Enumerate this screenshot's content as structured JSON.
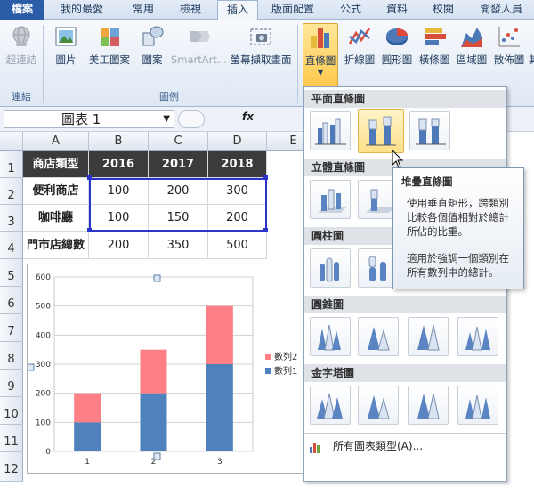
{
  "tabs": [
    "檔案",
    "我的最愛",
    "常用",
    "檢視",
    "插入",
    "版面配置",
    "公式",
    "資料",
    "校閱",
    "開發人員"
  ],
  "ribbon": {
    "buttons": [
      {
        "label": "超連結",
        "icon": "globe-link-icon"
      },
      {
        "label": "圖片",
        "icon": "picture-icon"
      },
      {
        "label": "美工圖案",
        "icon": "clipart-icon"
      },
      {
        "label": "圖案",
        "icon": "shapes-icon"
      },
      {
        "label": "SmartArt...",
        "icon": "smartart-icon"
      },
      {
        "label": "螢幕擷取畫面",
        "icon": "screenshot-icon"
      },
      {
        "label": "直條圖",
        "icon": "column-chart-icon"
      },
      {
        "label": "折線圖",
        "icon": "line-chart-icon"
      },
      {
        "label": "圓形圖",
        "icon": "pie-chart-icon"
      },
      {
        "label": "橫條圖",
        "icon": "bar-chart-icon"
      },
      {
        "label": "區域圖",
        "icon": "area-chart-icon"
      },
      {
        "label": "散佈圖",
        "icon": "scatter-chart-icon"
      },
      {
        "label": "其"
      }
    ],
    "groups": [
      "連結",
      "圖例"
    ]
  },
  "namebox": "圖表 1",
  "fx": "fx",
  "columns": [
    "A",
    "B",
    "C",
    "D",
    "E"
  ],
  "rows": [
    "1",
    "2",
    "3",
    "4",
    "5",
    "6",
    "7",
    "8",
    "9",
    "10",
    "11",
    "12"
  ],
  "table": {
    "header": [
      "商店類型",
      "2016",
      "2017",
      "2018"
    ],
    "data": [
      [
        "便利商店",
        "100",
        "200",
        "300"
      ],
      [
        "咖啡廳",
        "100",
        "150",
        "200"
      ],
      [
        "門市店總數",
        "200",
        "350",
        "500"
      ]
    ]
  },
  "chart_data": {
    "type": "bar",
    "stacked": true,
    "categories": [
      "1",
      "2",
      "3"
    ],
    "series": [
      {
        "name": "數列1",
        "values": [
          100,
          200,
          300
        ],
        "color": "#4f81bd"
      },
      {
        "name": "數列2",
        "values": [
          100,
          150,
          200
        ],
        "color": "#ff7f86"
      }
    ],
    "ylim": [
      0,
      600
    ],
    "yticks": [
      "0",
      "100",
      "200",
      "300",
      "400",
      "500",
      "600"
    ],
    "legend": "right",
    "grid": true
  },
  "menu": {
    "sections": [
      "平面直條圖",
      "立體直條圖",
      "圓柱圖",
      "圓錐圖",
      "金字塔圖"
    ],
    "footer": "所有圖表類型(A)..."
  },
  "tooltip": {
    "title": "堆疊直條圖",
    "body1": "使用垂直矩形，跨類別比較各個值相對於總計所佔的比重。",
    "body2": "適用於強調一個類別在所有數列中的總計。"
  }
}
